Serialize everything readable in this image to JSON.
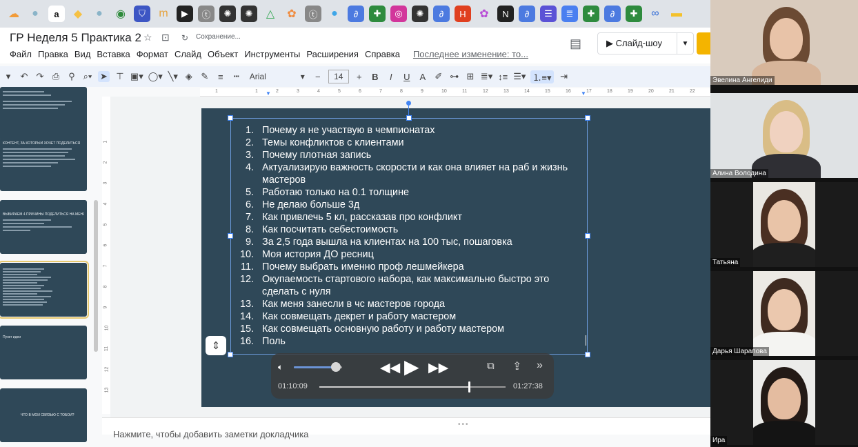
{
  "bookmarks": [
    {
      "icon": "cloud-icon",
      "color": "#f29b38"
    },
    {
      "icon": "dot-icon",
      "color": "#8ab4c8"
    },
    {
      "icon": "amazon-icon",
      "color": "#ffffff",
      "label": "a"
    },
    {
      "icon": "diamond-icon",
      "color": "#f6c143"
    },
    {
      "icon": "dot-icon",
      "color": "#8ab4c8"
    },
    {
      "icon": "eye-icon",
      "color": "#2d8a3a"
    },
    {
      "icon": "shield-icon",
      "color": "#3d56c4"
    },
    {
      "icon": "tm-icon",
      "color": "#e6a23c"
    },
    {
      "icon": "play-icon",
      "color": "#222222"
    },
    {
      "icon": "t-circle-icon",
      "color": "#888888"
    },
    {
      "icon": "chatgpt-icon",
      "color": "#333333"
    },
    {
      "icon": "chatgpt-icon",
      "color": "#333333"
    },
    {
      "icon": "drive-icon",
      "color": "#34a853"
    },
    {
      "icon": "flower-icon",
      "color": "#f08a3c"
    },
    {
      "icon": "t-circle-icon",
      "color": "#888888"
    },
    {
      "icon": "circle-icon",
      "color": "#3ea6e8"
    },
    {
      "icon": "link-icon",
      "color": "#4c7ae0"
    },
    {
      "icon": "plus-icon",
      "color": "#2e8b3e"
    },
    {
      "icon": "instagram-icon",
      "color": "#d2369b"
    },
    {
      "icon": "chatgpt-icon",
      "color": "#333333"
    },
    {
      "icon": "link-icon",
      "color": "#4c7ae0"
    },
    {
      "icon": "h-icon",
      "color": "#e0401f"
    },
    {
      "icon": "flower-icon",
      "color": "#b84bd6"
    },
    {
      "icon": "notion-icon",
      "color": "#222222"
    },
    {
      "icon": "link-icon",
      "color": "#4c7ae0"
    },
    {
      "icon": "forms-icon",
      "color": "#5b52d6"
    },
    {
      "icon": "docs-icon",
      "color": "#4a7ff0"
    },
    {
      "icon": "plus-icon",
      "color": "#2e8b3e"
    },
    {
      "icon": "link-icon",
      "color": "#4c7ae0"
    },
    {
      "icon": "plus-icon",
      "color": "#2e8b3e"
    },
    {
      "icon": "meta-icon",
      "color": "#2e69d6"
    },
    {
      "icon": "folder-icon",
      "color": "#f4c12b"
    }
  ],
  "app": {
    "title": "ГР Неделя 5 Практика 2",
    "saving": "Сохранение...",
    "menu": [
      "Файл",
      "Правка",
      "Вид",
      "Вставка",
      "Формат",
      "Слайд",
      "Объект",
      "Инструменты",
      "Расширения",
      "Справка"
    ],
    "last_edit": "Последнее изменение: то...",
    "slideshow": "Слайд-шоу"
  },
  "toolbar": {
    "font": "Arial",
    "font_size": "14"
  },
  "ruler": {
    "top": [
      "1",
      "1",
      "2",
      "3",
      "4",
      "5",
      "6",
      "7",
      "8",
      "9",
      "10",
      "11",
      "12",
      "13",
      "14",
      "15",
      "16",
      "17",
      "18",
      "19",
      "20",
      "21",
      "22"
    ],
    "left": [
      "1",
      "2",
      "3",
      "4",
      "5",
      "6",
      "7",
      "8",
      "9",
      "10",
      "11",
      "12",
      "13"
    ]
  },
  "slide": {
    "items": [
      {
        "num": "1.",
        "text": "Почему я не участвую в чемпионатах"
      },
      {
        "num": "2.",
        "text": "Темы конфликтов с клиентами"
      },
      {
        "num": "3.",
        "text": "Почему плотная запись"
      },
      {
        "num": "4.",
        "text": "Актуализирую важность скорости и как она влияет на раб и жизнь мастеров"
      },
      {
        "num": "5.",
        "text": "Работаю только на 0.1 толщине"
      },
      {
        "num": "6.",
        "text": "Не делаю больше 3д"
      },
      {
        "num": "7.",
        "text": "Как привлечь 5 кл, рассказав про конфликт"
      },
      {
        "num": "8.",
        "text": "Как  посчитать себестоимость"
      },
      {
        "num": "9.",
        "text": "За 2,5 года вышла на клиентах на 100 тыс, пошаговка"
      },
      {
        "num": "10.",
        "text": "Моя история ДО ресниц"
      },
      {
        "num": "11.",
        "text": "Почему выбрать именно проф лешмейкера"
      },
      {
        "num": "12.",
        "text": "Окупаемость стартового набора, как максимально быстро это сделать с нуля"
      },
      {
        "num": "13.",
        "text": "Как меня занесли в чс мастеров города"
      },
      {
        "num": "14.",
        "text": "Как совмещать декрет и работу мастером"
      },
      {
        "num": "15.",
        "text": "Как совмещать основную работу и работу мастером"
      },
      {
        "num": "16.",
        "text": "Поль"
      }
    ]
  },
  "thumbnails": [
    {
      "title": ""
    },
    {
      "title": "КОНТЕНТ, ЗА КОТОРЫЙ ХОЧЕТ ПОДЕЛИТЬСЯ"
    },
    {
      "title": "ВЫБИРАЕМ 4 ПРИЧИНЫ ПОДЕЛИТЬСЯ НА МЕНЯ"
    },
    {
      "title": ""
    },
    {
      "title": "Пункт идеи"
    },
    {
      "title": "ЧТО В МОЙ СВЯЗЬЮ С ТОБОЙ?"
    }
  ],
  "player": {
    "current_time": "01:10:09",
    "duration": "01:27:38",
    "progress": 0.8,
    "volume": 0.85
  },
  "notes": {
    "placeholder": "Нажмите, чтобы добавить заметки докладчика"
  },
  "participants": [
    {
      "name": "Эвелина Ангелиди",
      "bg": "#d9cbbd",
      "skin": "#e8c3a8",
      "hair": "#6b4a33",
      "shirt": "#d7b59a"
    },
    {
      "name": "Алина Володина",
      "bg": "#dfe2e4",
      "skin": "#f0d2c0",
      "hair": "#d9bd86",
      "shirt": "#2f2f34"
    },
    {
      "name": "Татьяна",
      "bg": "#e9e7e2",
      "skin": "#e9c4a8",
      "hair": "#4a2f22",
      "shirt": "#1f1f1f"
    },
    {
      "name": "Дарья Шарапова",
      "bg": "#ece9e4",
      "skin": "#ebc8ae",
      "hair": "#3f2a20",
      "shirt": "#f4f4f2"
    },
    {
      "name": "Ира",
      "bg": "#ececea",
      "skin": "#e4bca0",
      "hair": "#231a16",
      "shirt": "#141414"
    }
  ]
}
